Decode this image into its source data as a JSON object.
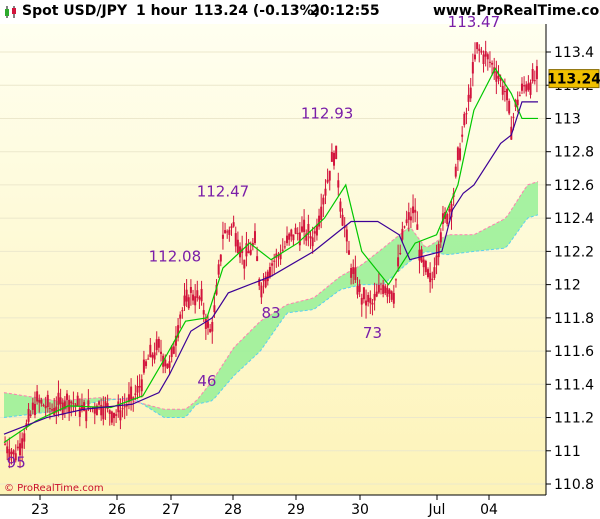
{
  "header": {
    "instrument": "Spot USD/JPY",
    "timeframe": "1 hour",
    "quote": "113.24 (-0.13%)",
    "time": "20:12:55",
    "site": "www.ProRealTime.com"
  },
  "watermark": "© ProRealTime.com",
  "colors": {
    "plot_bg_top": "#fffff0",
    "plot_bg_bottom": "#fdf3b8",
    "candle": "#d2143c",
    "tenkan": "#00c800",
    "kijun": "#3c0096",
    "kumo_bull": "#96f096",
    "kumo_bear": "#f8bcdc",
    "last_price_bg": "#f0c000",
    "annotation": "#7a1ea8"
  },
  "chart_data": {
    "type": "candlestick",
    "indicator": "Ichimoku",
    "ylim": [
      110.75,
      113.55
    ],
    "y_ticks": [
      "113.4",
      "113.2",
      "113",
      "112.8",
      "112.6",
      "112.4",
      "112.2",
      "112",
      "111.8",
      "111.6",
      "111.4",
      "111.2",
      "111",
      "110.8"
    ],
    "x_ticks": [
      "23",
      "26",
      "27",
      "28",
      "29",
      "30",
      "Jul",
      "04"
    ],
    "last_price": "113.24",
    "annotations": [
      {
        "label": "113.47",
        "bar": 0.88,
        "price": 113.55
      },
      {
        "label": "112.93",
        "bar": 0.605,
        "price": 113.0
      },
      {
        "label": "112.47",
        "bar": 0.41,
        "price": 112.53
      },
      {
        "label": "112.08",
        "bar": 0.32,
        "price": 112.14
      },
      {
        "label": "95",
        "bar": 0.005,
        "price": 110.9
      },
      {
        "label": "46",
        "bar": 0.38,
        "price": 111.39
      },
      {
        "label": "83",
        "bar": 0.5,
        "price": 111.8
      },
      {
        "label": "73",
        "bar": 0.69,
        "price": 111.68
      }
    ],
    "price_path": [
      [
        0.0,
        111.05
      ],
      [
        0.02,
        110.97
      ],
      [
        0.04,
        111.12
      ],
      [
        0.06,
        111.3
      ],
      [
        0.09,
        111.25
      ],
      [
        0.12,
        111.31
      ],
      [
        0.15,
        111.24
      ],
      [
        0.18,
        111.28
      ],
      [
        0.21,
        111.22
      ],
      [
        0.23,
        111.28
      ],
      [
        0.25,
        111.35
      ],
      [
        0.27,
        111.55
      ],
      [
        0.29,
        111.62
      ],
      [
        0.31,
        111.5
      ],
      [
        0.33,
        111.82
      ],
      [
        0.35,
        111.95
      ],
      [
        0.37,
        111.9
      ],
      [
        0.385,
        111.7
      ],
      [
        0.395,
        111.85
      ],
      [
        0.41,
        112.3
      ],
      [
        0.43,
        112.35
      ],
      [
        0.45,
        112.15
      ],
      [
        0.47,
        112.25
      ],
      [
        0.48,
        111.98
      ],
      [
        0.5,
        112.12
      ],
      [
        0.52,
        112.2
      ],
      [
        0.54,
        112.3
      ],
      [
        0.56,
        112.32
      ],
      [
        0.58,
        112.28
      ],
      [
        0.6,
        112.55
      ],
      [
        0.62,
        112.82
      ],
      [
        0.63,
        112.5
      ],
      [
        0.65,
        112.1
      ],
      [
        0.67,
        111.92
      ],
      [
        0.69,
        111.88
      ],
      [
        0.71,
        112.0
      ],
      [
        0.73,
        111.95
      ],
      [
        0.75,
        112.35
      ],
      [
        0.77,
        112.45
      ],
      [
        0.78,
        112.15
      ],
      [
        0.8,
        112.0
      ],
      [
        0.82,
        112.35
      ],
      [
        0.84,
        112.5
      ],
      [
        0.85,
        112.75
      ],
      [
        0.87,
        113.1
      ],
      [
        0.885,
        113.42
      ],
      [
        0.9,
        113.38
      ],
      [
        0.92,
        113.3
      ],
      [
        0.94,
        113.15
      ],
      [
        0.95,
        112.95
      ],
      [
        0.96,
        113.1
      ],
      [
        0.975,
        113.2
      ],
      [
        1.0,
        113.24
      ]
    ],
    "tenkan": [
      [
        0.0,
        111.05
      ],
      [
        0.06,
        111.18
      ],
      [
        0.12,
        111.27
      ],
      [
        0.2,
        111.26
      ],
      [
        0.26,
        111.33
      ],
      [
        0.3,
        111.55
      ],
      [
        0.34,
        111.78
      ],
      [
        0.38,
        111.8
      ],
      [
        0.41,
        112.1
      ],
      [
        0.46,
        112.25
      ],
      [
        0.5,
        112.15
      ],
      [
        0.55,
        112.25
      ],
      [
        0.6,
        112.4
      ],
      [
        0.64,
        112.6
      ],
      [
        0.67,
        112.2
      ],
      [
        0.72,
        112.0
      ],
      [
        0.77,
        112.25
      ],
      [
        0.81,
        112.3
      ],
      [
        0.85,
        112.6
      ],
      [
        0.88,
        113.05
      ],
      [
        0.92,
        113.3
      ],
      [
        0.95,
        113.15
      ],
      [
        0.97,
        113.0
      ],
      [
        1.0,
        113.0
      ]
    ],
    "kijun": [
      [
        0.0,
        111.1
      ],
      [
        0.08,
        111.2
      ],
      [
        0.15,
        111.25
      ],
      [
        0.24,
        111.28
      ],
      [
        0.29,
        111.35
      ],
      [
        0.31,
        111.46
      ],
      [
        0.35,
        111.72
      ],
      [
        0.39,
        111.8
      ],
      [
        0.42,
        111.95
      ],
      [
        0.5,
        112.05
      ],
      [
        0.58,
        112.2
      ],
      [
        0.65,
        112.38
      ],
      [
        0.7,
        112.38
      ],
      [
        0.74,
        112.3
      ],
      [
        0.76,
        112.15
      ],
      [
        0.82,
        112.2
      ],
      [
        0.84,
        112.45
      ],
      [
        0.86,
        112.55
      ],
      [
        0.88,
        112.6
      ],
      [
        0.93,
        112.85
      ],
      [
        0.95,
        112.9
      ],
      [
        0.97,
        113.1
      ],
      [
        1.0,
        113.1
      ]
    ],
    "senkou_a": [
      [
        0.0,
        111.35
      ],
      [
        0.1,
        111.3
      ],
      [
        0.18,
        111.32
      ],
      [
        0.24,
        111.3
      ],
      [
        0.3,
        111.25
      ],
      [
        0.34,
        111.25
      ],
      [
        0.36,
        111.3
      ],
      [
        0.39,
        111.42
      ],
      [
        0.43,
        111.62
      ],
      [
        0.48,
        111.78
      ],
      [
        0.53,
        111.88
      ],
      [
        0.58,
        111.92
      ],
      [
        0.63,
        112.05
      ],
      [
        0.67,
        112.12
      ],
      [
        0.71,
        112.22
      ],
      [
        0.76,
        112.35
      ],
      [
        0.79,
        112.22
      ],
      [
        0.83,
        112.3
      ],
      [
        0.88,
        112.3
      ],
      [
        0.94,
        112.4
      ],
      [
        0.98,
        112.6
      ],
      [
        1.0,
        112.62
      ]
    ],
    "senkou_b": [
      [
        0.0,
        111.2
      ],
      [
        0.1,
        111.24
      ],
      [
        0.18,
        111.3
      ],
      [
        0.24,
        111.32
      ],
      [
        0.3,
        111.2
      ],
      [
        0.34,
        111.2
      ],
      [
        0.36,
        111.28
      ],
      [
        0.39,
        111.3
      ],
      [
        0.43,
        111.45
      ],
      [
        0.48,
        111.6
      ],
      [
        0.53,
        111.83
      ],
      [
        0.58,
        111.85
      ],
      [
        0.63,
        111.97
      ],
      [
        0.67,
        112.0
      ],
      [
        0.71,
        112.0
      ],
      [
        0.76,
        112.14
      ],
      [
        0.79,
        112.2
      ],
      [
        0.83,
        112.18
      ],
      [
        0.88,
        112.2
      ],
      [
        0.94,
        112.22
      ],
      [
        0.98,
        112.4
      ],
      [
        1.0,
        112.42
      ]
    ]
  }
}
